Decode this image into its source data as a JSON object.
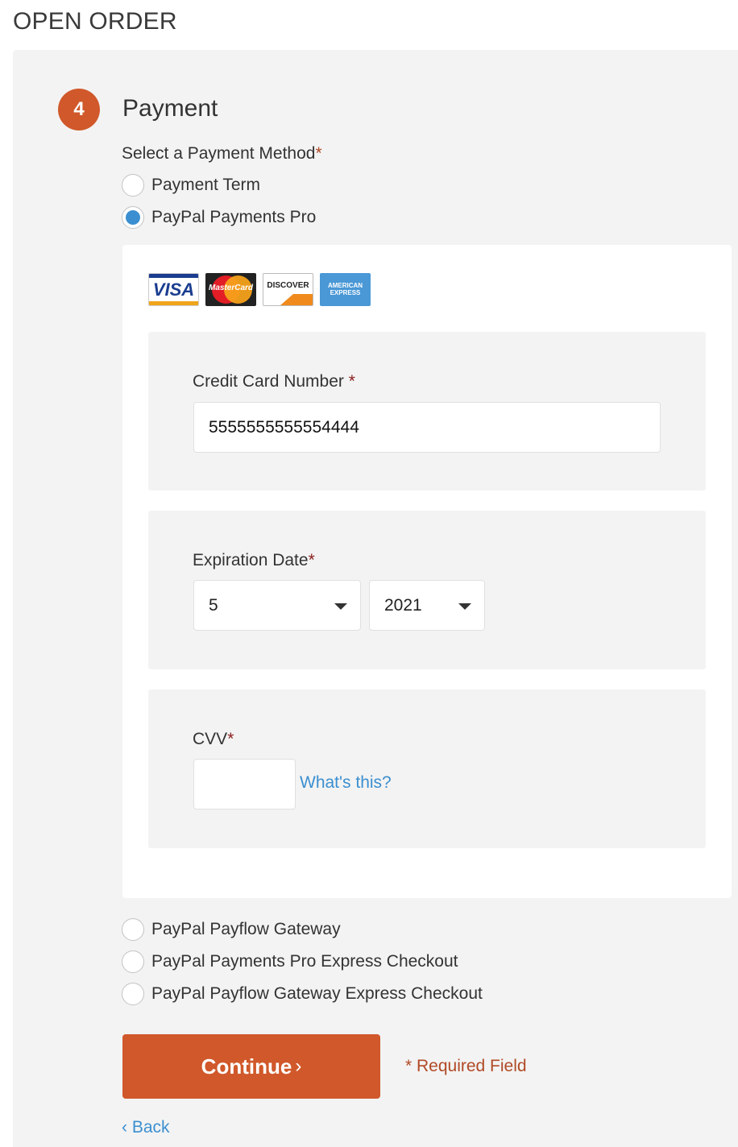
{
  "page_title": "OPEN ORDER",
  "step": {
    "number": "4",
    "title": "Payment"
  },
  "payment_method": {
    "label": "Select a Payment Method",
    "required_marker": "*",
    "options": [
      {
        "label": "Payment Term",
        "checked": false
      },
      {
        "label": "PayPal Payments Pro",
        "checked": true
      },
      {
        "label": "PayPal Payflow Gateway",
        "checked": false
      },
      {
        "label": "PayPal Payments Pro Express Checkout",
        "checked": false
      },
      {
        "label": "PayPal Payflow Gateway Express Checkout",
        "checked": false
      }
    ]
  },
  "card_logos": {
    "visa": "VISA",
    "mastercard": "MasterCard",
    "discover": "DISCOVER",
    "amex": "AMERICAN EXPRESS"
  },
  "credit_card": {
    "label": "Credit Card Number",
    "required_marker": "*",
    "value": "5555555555554444"
  },
  "expiration": {
    "label": "Expiration Date",
    "required_marker": "*",
    "month": "5",
    "year": "2021"
  },
  "cvv": {
    "label": "CVV",
    "required_marker": "*",
    "value": "",
    "help_link": "What's this?"
  },
  "actions": {
    "continue_label": "Continue",
    "continue_chevron": "›",
    "required_note": "* Required Field",
    "back_chevron": "‹",
    "back_label": "Back"
  },
  "colors": {
    "accent": "#d0582a",
    "link": "#3b8fd0",
    "panel_bg": "#f3f3f3"
  }
}
